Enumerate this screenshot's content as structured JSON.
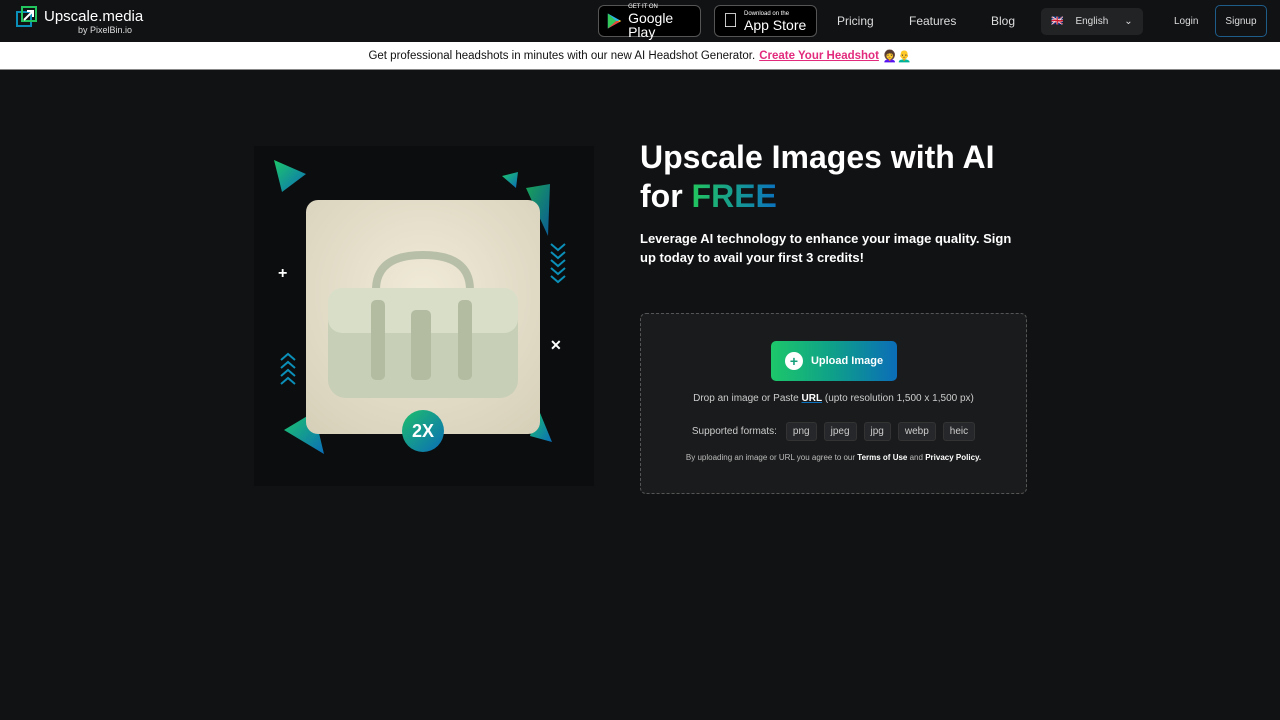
{
  "nav": {
    "logo_name": "Upscale.media",
    "logo_by": "by PixelBin.io",
    "google_play": {
      "small": "GET IT ON",
      "big": "Google Play"
    },
    "app_store": {
      "small": "Download on the",
      "big": "App Store"
    },
    "links": [
      "Pricing",
      "Features",
      "Blog"
    ],
    "language": "English",
    "login": "Login",
    "signup": "Signup"
  },
  "banner": {
    "text": "Get professional headshots in minutes with our new AI Headshot Generator.",
    "link": "Create Your Headshot",
    "emoji": "👩‍🦱👨‍🦲"
  },
  "hero": {
    "badge": "2X",
    "title_line1": "Upscale Images with AI",
    "title_for": "for",
    "title_free": "FREE",
    "subtitle": "Leverage AI technology to enhance your image quality. Sign up today to avail your first 3 credits!"
  },
  "upload": {
    "button": "Upload Image",
    "hint_pre": "Drop an image or Paste",
    "hint_url": "URL",
    "hint_post": "(upto resolution 1,500 x 1,500 px)",
    "formats_label": "Supported formats:",
    "formats": [
      "png",
      "jpeg",
      "jpg",
      "webp",
      "heic"
    ],
    "legal_pre": "By uploading an image or URL you agree to our",
    "terms": "Terms of Use",
    "and": "and",
    "privacy": "Privacy Policy."
  },
  "colors": {
    "accent_green": "#1dc76a",
    "accent_blue": "#0b6db8",
    "link_pink": "#e22b7d"
  }
}
